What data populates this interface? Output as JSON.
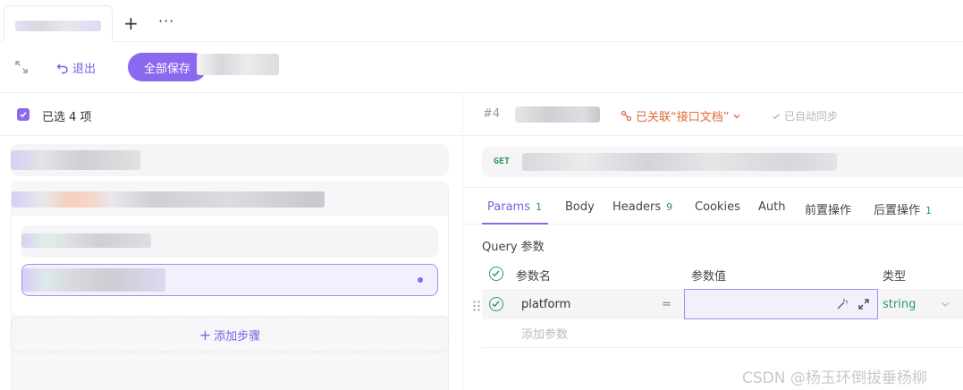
{
  "tabbar": {
    "add_label": "+",
    "more_label": "···"
  },
  "toolbar": {
    "exit_label": "退出",
    "save_all_label": "全部保存"
  },
  "left": {
    "selected_label": "已选 4 项",
    "add_step_label": "添加步骤"
  },
  "right": {
    "hash": "#4",
    "linked_label": "已关联“接口文档”",
    "auto_sync_label": "已自动同步",
    "method": "GET",
    "tabs": [
      {
        "label": "Params",
        "count": "1"
      },
      {
        "label": "Body",
        "count": ""
      },
      {
        "label": "Headers",
        "count": "9"
      },
      {
        "label": "Cookies",
        "count": ""
      },
      {
        "label": "Auth",
        "count": ""
      },
      {
        "label": "前置操作",
        "count": ""
      },
      {
        "label": "后置操作",
        "count": "1"
      }
    ],
    "query_label": "Query 参数",
    "params_header": {
      "name": "参数名",
      "value": "参数值",
      "type": "类型"
    },
    "param_row": {
      "name": "platform",
      "eq": "=",
      "value": "",
      "type": "string"
    },
    "add_param_placeholder": "添加参数"
  },
  "watermark": "CSDN @杨玉环倒拔垂杨柳",
  "colors": {
    "accent": "#8b69ee",
    "green": "#2c9a5a",
    "orange": "#e06b3a"
  }
}
